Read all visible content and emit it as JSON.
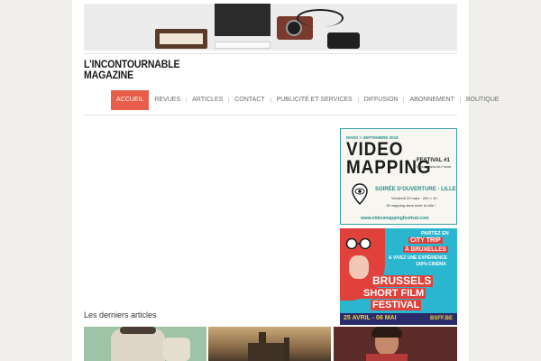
{
  "site": {
    "logo_line1": "L'INCONTOURNABLE",
    "logo_line2": "MAGAZINE"
  },
  "nav": {
    "items": [
      {
        "label": "ACCUEIL",
        "active": true
      },
      {
        "label": "REVUES"
      },
      {
        "label": "ARTICLES"
      },
      {
        "label": "CONTACT"
      },
      {
        "label": "PUBLICITÉ ET SERVICES"
      },
      {
        "label": "DIFFUSION"
      },
      {
        "label": "ABONNEMENT"
      },
      {
        "label": "BOUTIQUE"
      }
    ],
    "accent_color": "#e85c4a"
  },
  "ads": {
    "video_mapping": {
      "dates": "MARS > SEPTEMBRE 2018",
      "title_line1": "VIDEO",
      "title_line2": "MAPPING",
      "festival": "FESTIVAL #1",
      "region": "Région Hauts-de-France",
      "opening": "SOIRÉE D'OUVERTURE - LILLE",
      "opening_date": "Vendredi 23 mars · 20h > 1h",
      "tagline": "15 mapping dans toute la ville !",
      "url": "www.videomappingfestival.com"
    },
    "bsff": {
      "line1": "PARTEZ EN",
      "line2": "CITY TRIP",
      "line3": "À BRUXELLES",
      "line4": "& VIVEZ UNE EXPÉRIENCE",
      "line5": "100% CINÉMA",
      "brand1": "BRUSSELS",
      "brand2": "SHORT FILM",
      "brand3": "FESTIVAL",
      "dates": "25 AVRIL - 06 MAI",
      "url": "BSFF.BE"
    }
  },
  "latest": {
    "title": "Les derniers articles"
  }
}
